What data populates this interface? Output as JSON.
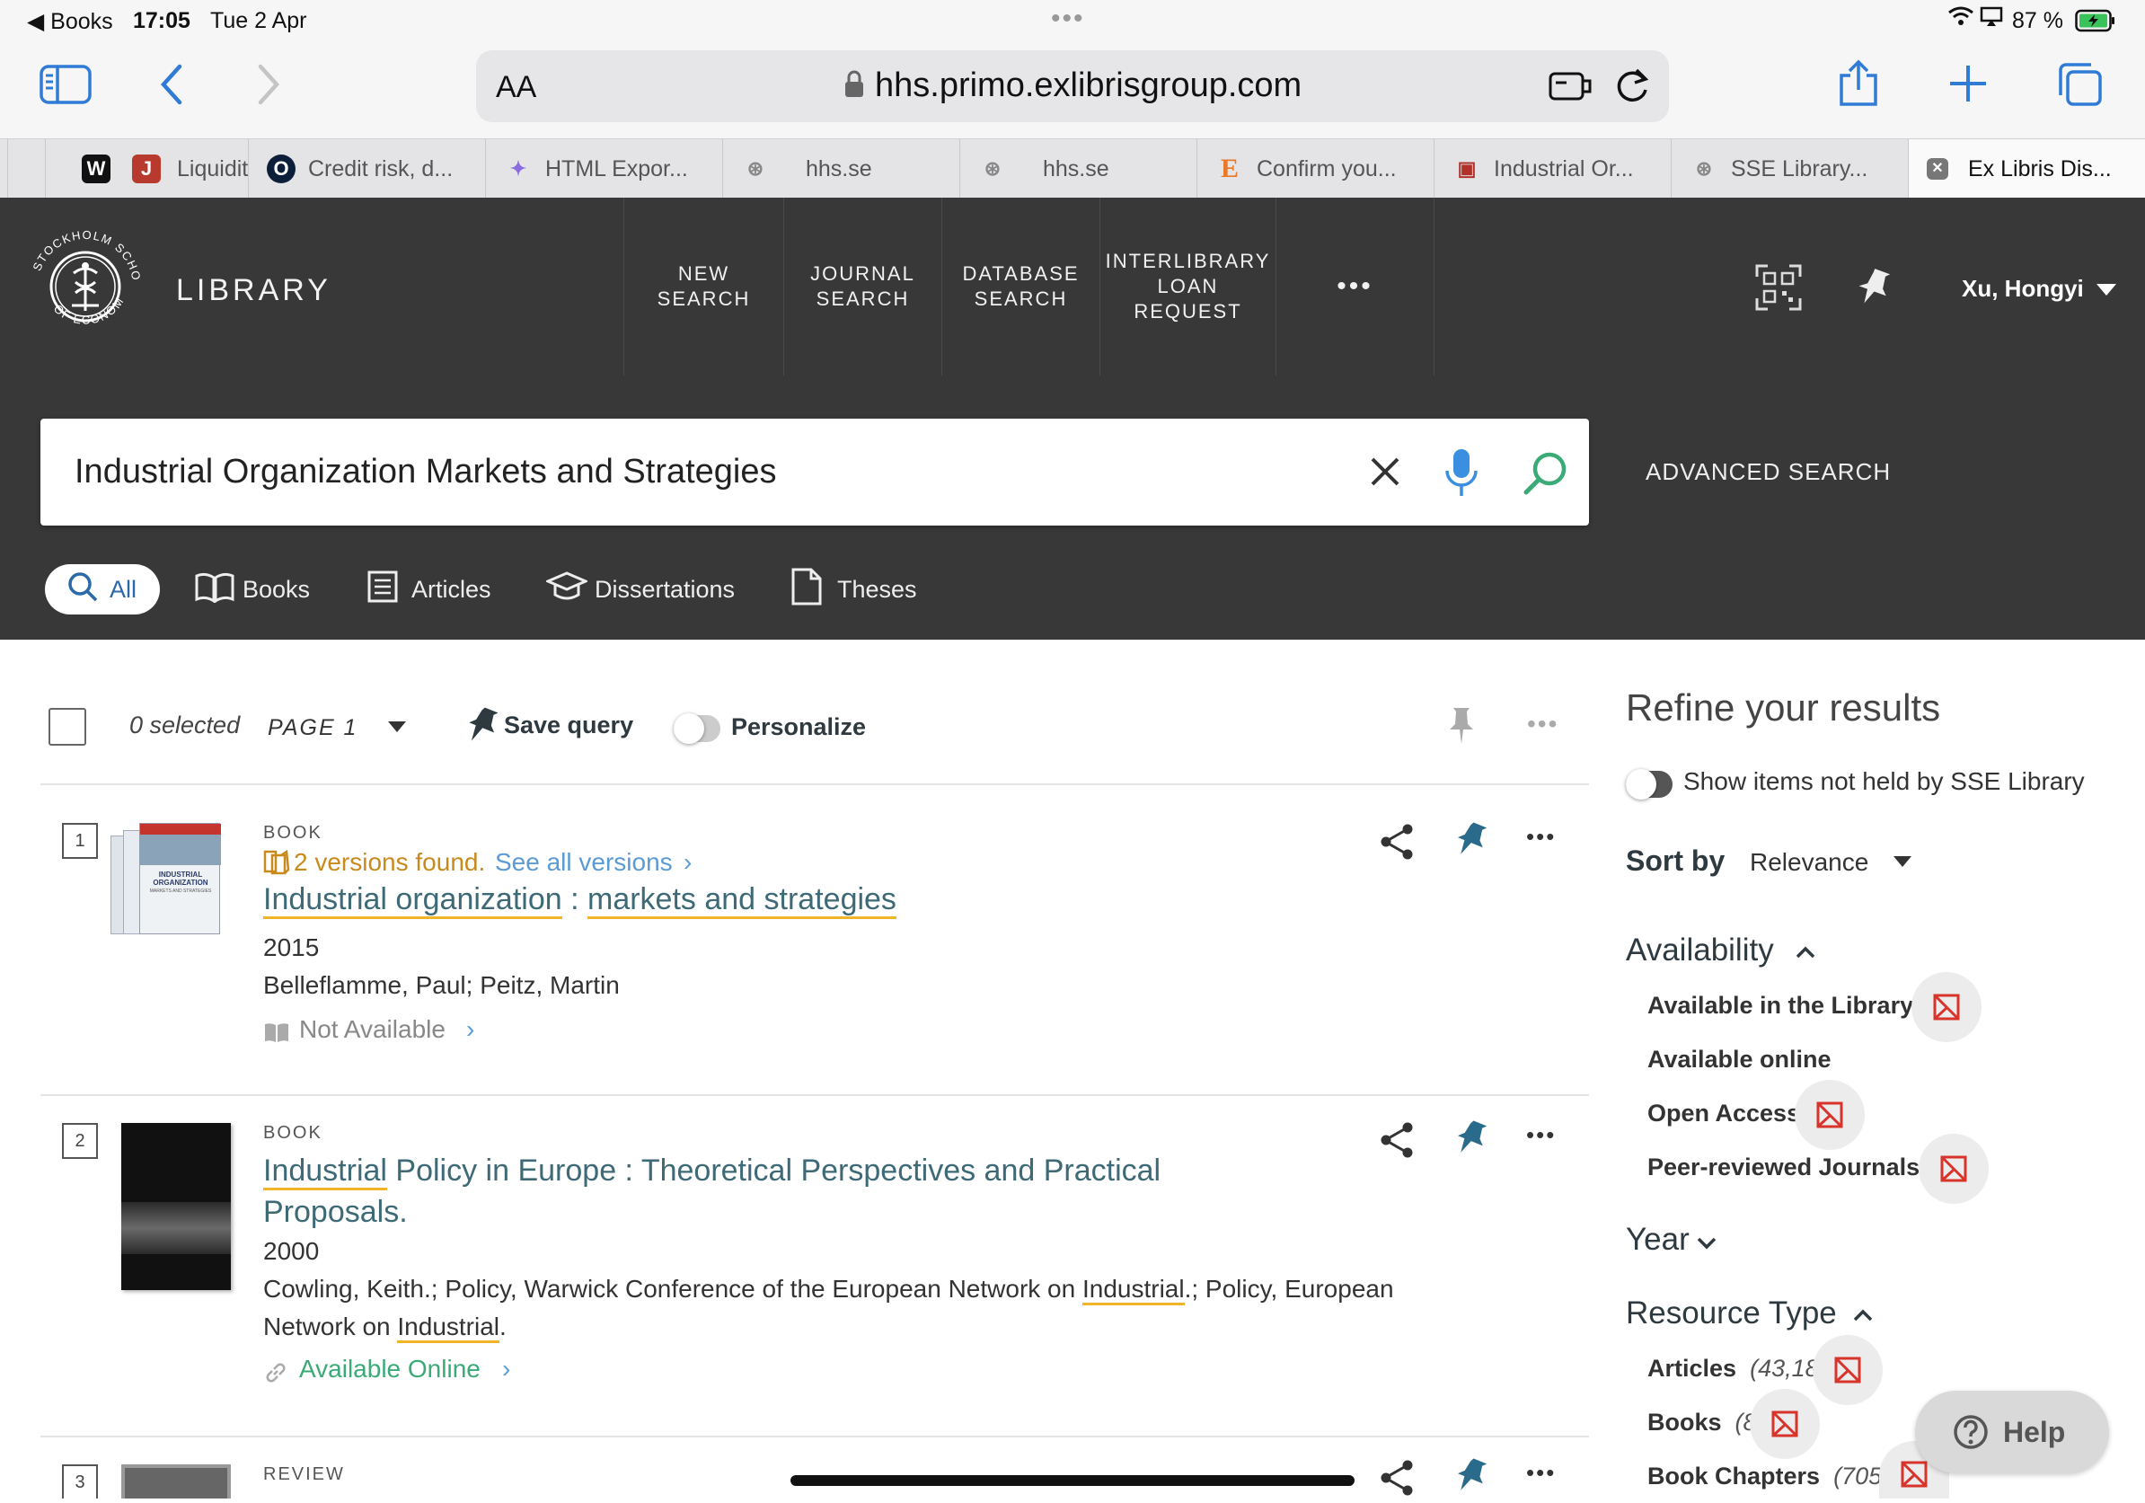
{
  "status_bar": {
    "back_app": "◀ Books",
    "time": "17:05",
    "date": "Tue 2 Apr",
    "battery": "87 %"
  },
  "browser": {
    "text_size_label": "AA",
    "url": "hhs.primo.exlibrisgroup.com",
    "tabs": [
      {
        "label": "",
        "fav": "W",
        "fav_color": "#111111"
      },
      {
        "label": "Liquidit",
        "fav": "J",
        "fav_color": "#b83a2e"
      },
      {
        "label": "Credit risk, d...",
        "fav": "O",
        "fav_color": "#0d1e3a"
      },
      {
        "label": "HTML Expor...",
        "fav": "✦",
        "fav_color": "#8a6be0"
      },
      {
        "label": "hhs.se",
        "fav": "⊛",
        "fav_color": "#888888"
      },
      {
        "label": "hhs.se",
        "fav": "⊛",
        "fav_color": "#888888"
      },
      {
        "label": "Confirm you...",
        "fav": "E",
        "fav_color": "#e8792b"
      },
      {
        "label": "Industrial Or...",
        "fav": "▣",
        "fav_color": "#b0302a"
      },
      {
        "label": "SSE Library...",
        "fav": "⊛",
        "fav_color": "#888888"
      },
      {
        "label": "Ex Libris Dis...",
        "fav": "✕",
        "fav_color": "#666666"
      }
    ]
  },
  "header": {
    "logo_text": "STOCKHOLM SCHOOL OF ECONOMICS",
    "library_label": "LIBRARY",
    "nav": [
      {
        "line1": "NEW",
        "line2": "SEARCH",
        "line3": ""
      },
      {
        "line1": "JOURNAL",
        "line2": "SEARCH",
        "line3": ""
      },
      {
        "line1": "DATABASE",
        "line2": "SEARCH",
        "line3": ""
      },
      {
        "line1": "INTERLIBRARY",
        "line2": "LOAN",
        "line3": "REQUEST"
      }
    ],
    "more": "•••",
    "user": "Xu, Hongyi"
  },
  "search": {
    "query": "Industrial Organization Markets and Strategies",
    "advanced": "ADVANCED SEARCH",
    "scopes": [
      "All",
      "Books",
      "Articles",
      "Dissertations",
      "Theses"
    ]
  },
  "results_bar": {
    "selected": "0 selected",
    "page": "PAGE 1",
    "save_query": "Save query",
    "personalize": "Personalize"
  },
  "records": [
    {
      "num": "1",
      "type": "BOOK",
      "versions": "2 versions found.",
      "see_all": "See all versions",
      "title_a": "Industrial organization",
      "title_sep": " : ",
      "title_b": "markets and strategies",
      "year": "2015",
      "authors": "Belleflamme, Paul; Peitz, Martin",
      "availability": "Not Available",
      "cover_title": "INDUSTRIAL ORGANIZATION",
      "cover_sub": "MARKETS AND STRATEGIES"
    },
    {
      "num": "2",
      "type": "BOOK",
      "title_a": "Industrial",
      "title_rest": " Policy in Europe : Theoretical Perspectives and Practical",
      "title_line2": "Proposals.",
      "year": "2000",
      "authors_1a": "Cowling, Keith.; Policy, Warwick Conference of the European Network on ",
      "authors_1b": "Industrial",
      "authors_1c": ".; Policy, European",
      "authors_2a": "Network on ",
      "authors_2b": "Industrial",
      "authors_2c": ".",
      "availability": "Available Online"
    },
    {
      "num": "3",
      "type": "REVIEW"
    }
  ],
  "refine": {
    "title": "Refine your results",
    "show_not_held": "Show items not held by SSE Library",
    "sort_label": "Sort by",
    "sort_value": "Relevance",
    "availability_h": "Availability",
    "availability_items": [
      "Available in the Library",
      "Available online",
      "Open Access",
      "Peer-reviewed Journals"
    ],
    "year_h": "Year",
    "resource_h": "Resource Type",
    "resource_items": [
      {
        "label": "Articles",
        "count": "(43,189)"
      },
      {
        "label": "Books",
        "count": "(899)"
      },
      {
        "label": "Book Chapters",
        "count": "(705)"
      }
    ]
  },
  "help": "Help",
  "colors": {
    "header_bg": "#383838",
    "link_teal": "#3d6a76",
    "underline_gold": "#f0b429",
    "versions_orange": "#c98a1c",
    "see_all_blue": "#5b9bd5",
    "available_green": "#3aaa76",
    "exclude_red": "#d9342b",
    "ios_blue": "#2f7bd6"
  }
}
